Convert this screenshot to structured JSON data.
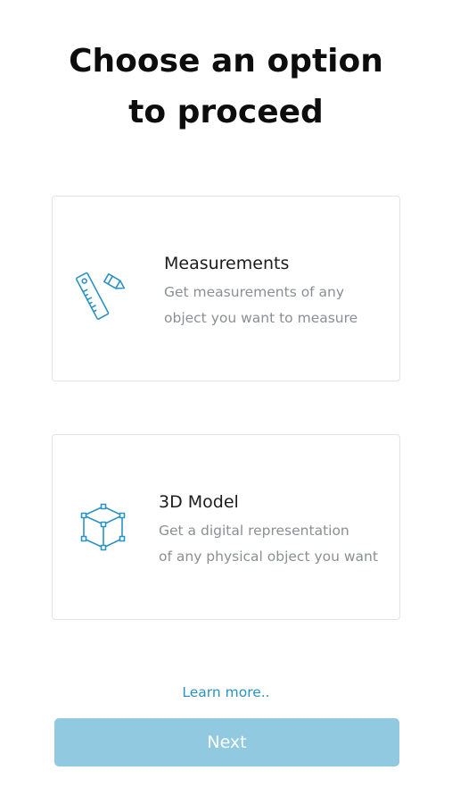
{
  "title": {
    "line1": "Choose an option",
    "line2": "to proceed"
  },
  "options": [
    {
      "title": "Measurements",
      "desc_line1": "Get measurements of any",
      "desc_line2": "object you want to measure",
      "icon": "ruler-pencil-icon"
    },
    {
      "title": "3D Model",
      "desc_line1": "Get a digital representation",
      "desc_line2": "of any physical object you want",
      "icon": "cube-3d-icon"
    }
  ],
  "learn_more": "Learn more..",
  "next_label": "Next",
  "colors": {
    "accent": "#2b93c4",
    "icon_stroke": "#2b93c4",
    "button_disabled": "#90c9e0",
    "card_border": "#e1e3e6",
    "description": "#8b8f94"
  }
}
